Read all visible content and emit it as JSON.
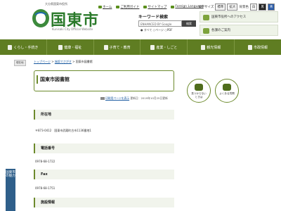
{
  "header": {
    "logo_top": "大分県国東市役所",
    "logo_name": "国東市",
    "logo_sub": "Kunisaki City Official Website",
    "toplinks": [
      {
        "icon": "home-icon",
        "label": "ホーム"
      },
      {
        "icon": "guide-icon",
        "label": "ご利用ガイド"
      },
      {
        "icon": "sitemap-icon",
        "label": "サイトマップ"
      },
      {
        "icon": "globe-icon",
        "label": "Foreign Language"
      }
    ],
    "font_size_label": "文字サイズ",
    "font_size_std": "標準",
    "font_size_big": "拡大",
    "bg_color_label": "背景色",
    "bg_color_white": "白",
    "bg_color_black": "黒",
    "bg_color_blue": "青"
  },
  "search": {
    "title": "キーワード検索",
    "placeholder": "ENHANCED BY Google",
    "button": "検索",
    "radio_all": "すべて",
    "radio_page": "ページ",
    "radio_pdf": "PDF"
  },
  "access": {
    "city_hall": "国東市役所へのアクセス",
    "offices": "各課のご案内"
  },
  "nav": [
    {
      "icon": "life-icon",
      "label": "くらし・手続き"
    },
    {
      "icon": "health-icon",
      "label": "健康・福祉"
    },
    {
      "icon": "child-icon",
      "label": "子育て・教育"
    },
    {
      "icon": "industry-icon",
      "label": "産業・しごと"
    },
    {
      "icon": "tourism-icon",
      "label": "観光情報"
    },
    {
      "icon": "admin-icon",
      "label": "市政情報"
    }
  ],
  "breadcrumb": {
    "tag": "現在地",
    "items": [
      "トップページ",
      "施設でさがす",
      "国東市図書館"
    ],
    "sep": " > "
  },
  "page": {
    "title": "国東市図書館",
    "print_label": "印刷用ページを表示",
    "updated": "更新日：2019年10月25日更新"
  },
  "sections": [
    {
      "heading": "所在地",
      "text": "〒873-0412　国東市武蔵町古市1136番地1"
    },
    {
      "heading": "電話番号",
      "text": "0978-68-1722"
    },
    {
      "heading": "Fax",
      "text": "0978-68-1751"
    },
    {
      "heading": "施設情報",
      "text": ""
    }
  ],
  "side": {
    "not_found": "見つからない\nときは",
    "faq": "よくある質問"
  },
  "float_tag": "国東市\nの魅力"
}
